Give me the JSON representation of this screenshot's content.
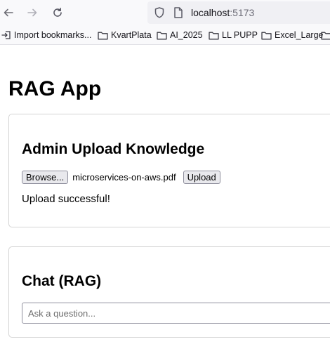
{
  "browser": {
    "url_host": "localhost",
    "url_port": ":5173",
    "bookmarks": [
      {
        "label": "Import bookmarks...",
        "icon": "import-icon"
      },
      {
        "label": "KvartPlata",
        "icon": "folder-icon"
      },
      {
        "label": "AI_2025",
        "icon": "folder-icon"
      },
      {
        "label": "LL PUPP",
        "icon": "folder-icon"
      },
      {
        "label": "Excel_Large",
        "icon": "folder-icon"
      }
    ]
  },
  "app": {
    "title": "RAG App",
    "upload": {
      "heading": "Admin Upload Knowledge",
      "browse_label": "Browse...",
      "file_name": "microservices-on-aws.pdf",
      "upload_label": "Upload",
      "status": "Upload successful!"
    },
    "chat": {
      "heading": "Chat (RAG)",
      "placeholder": "Ask a question...",
      "value": ""
    }
  },
  "colors": {
    "toolbar_bg": "#f9f9fb",
    "urlbar_bg": "#f0f0f4",
    "card_border": "#d4d4d4",
    "button_bg": "#e9e9ed"
  }
}
